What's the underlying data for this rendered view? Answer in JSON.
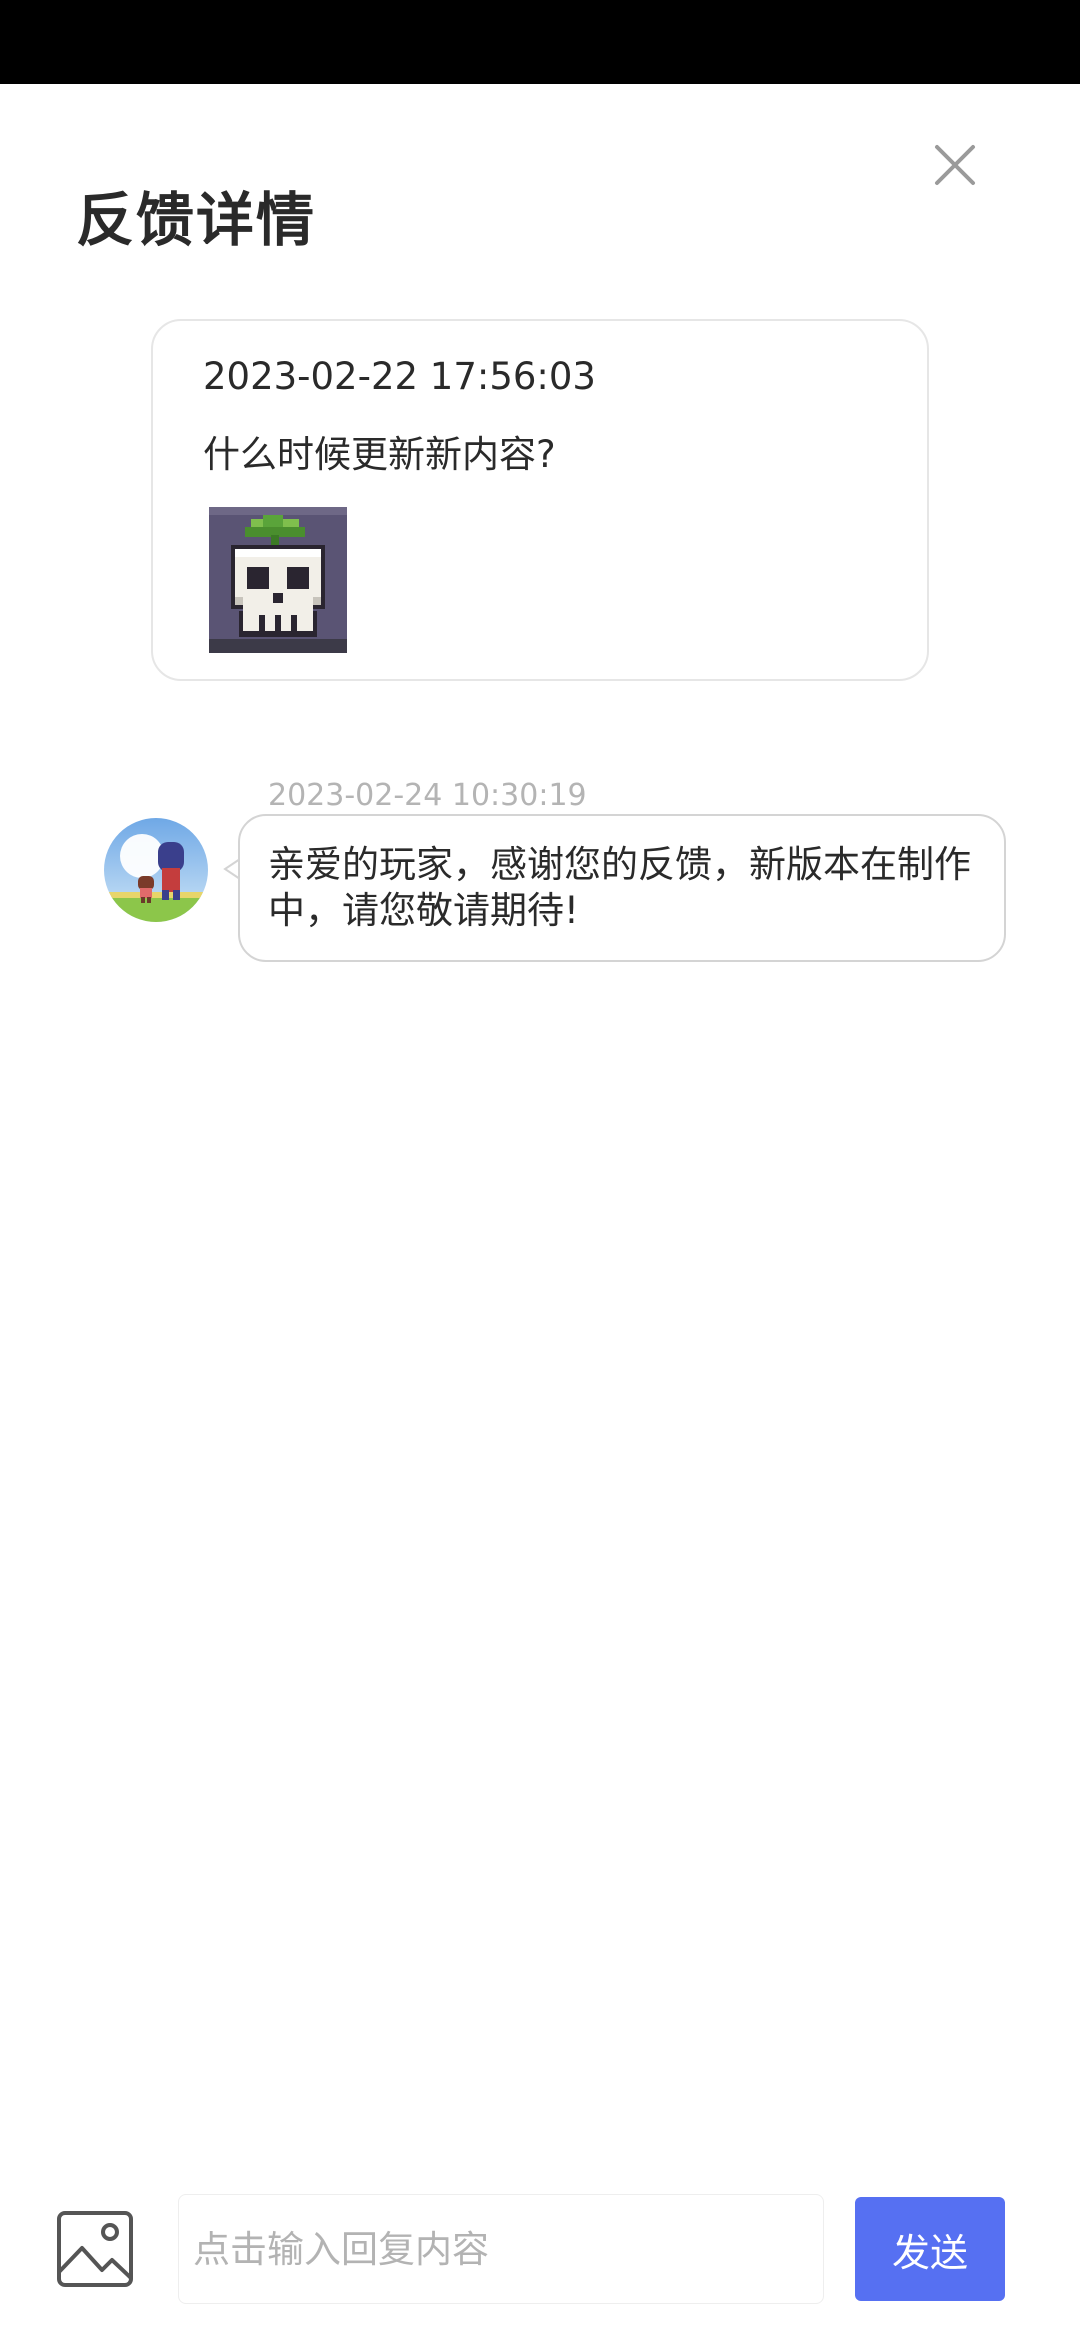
{
  "header": {
    "title": "反馈详情",
    "close_icon": "close-icon"
  },
  "feedback": {
    "timestamp": "2023-02-22 17:56:03",
    "text": "什么时候更新新内容?",
    "attachment_icon": "skull-sprite-image"
  },
  "reply": {
    "timestamp": "2023-02-24 10:30:19",
    "text": "亲爱的玩家，感谢您的反馈，新版本在制作中，请您敬请期待!",
    "avatar_icon": "developer-avatar"
  },
  "composer": {
    "image_icon": "image-icon",
    "placeholder": "点击输入回复内容",
    "value": "",
    "send_label": "发送"
  },
  "colors": {
    "accent": "#5670f2",
    "status_bar": "#000000",
    "timestamp_gray": "#b4b4b4",
    "card_border": "#e6e6e6"
  }
}
